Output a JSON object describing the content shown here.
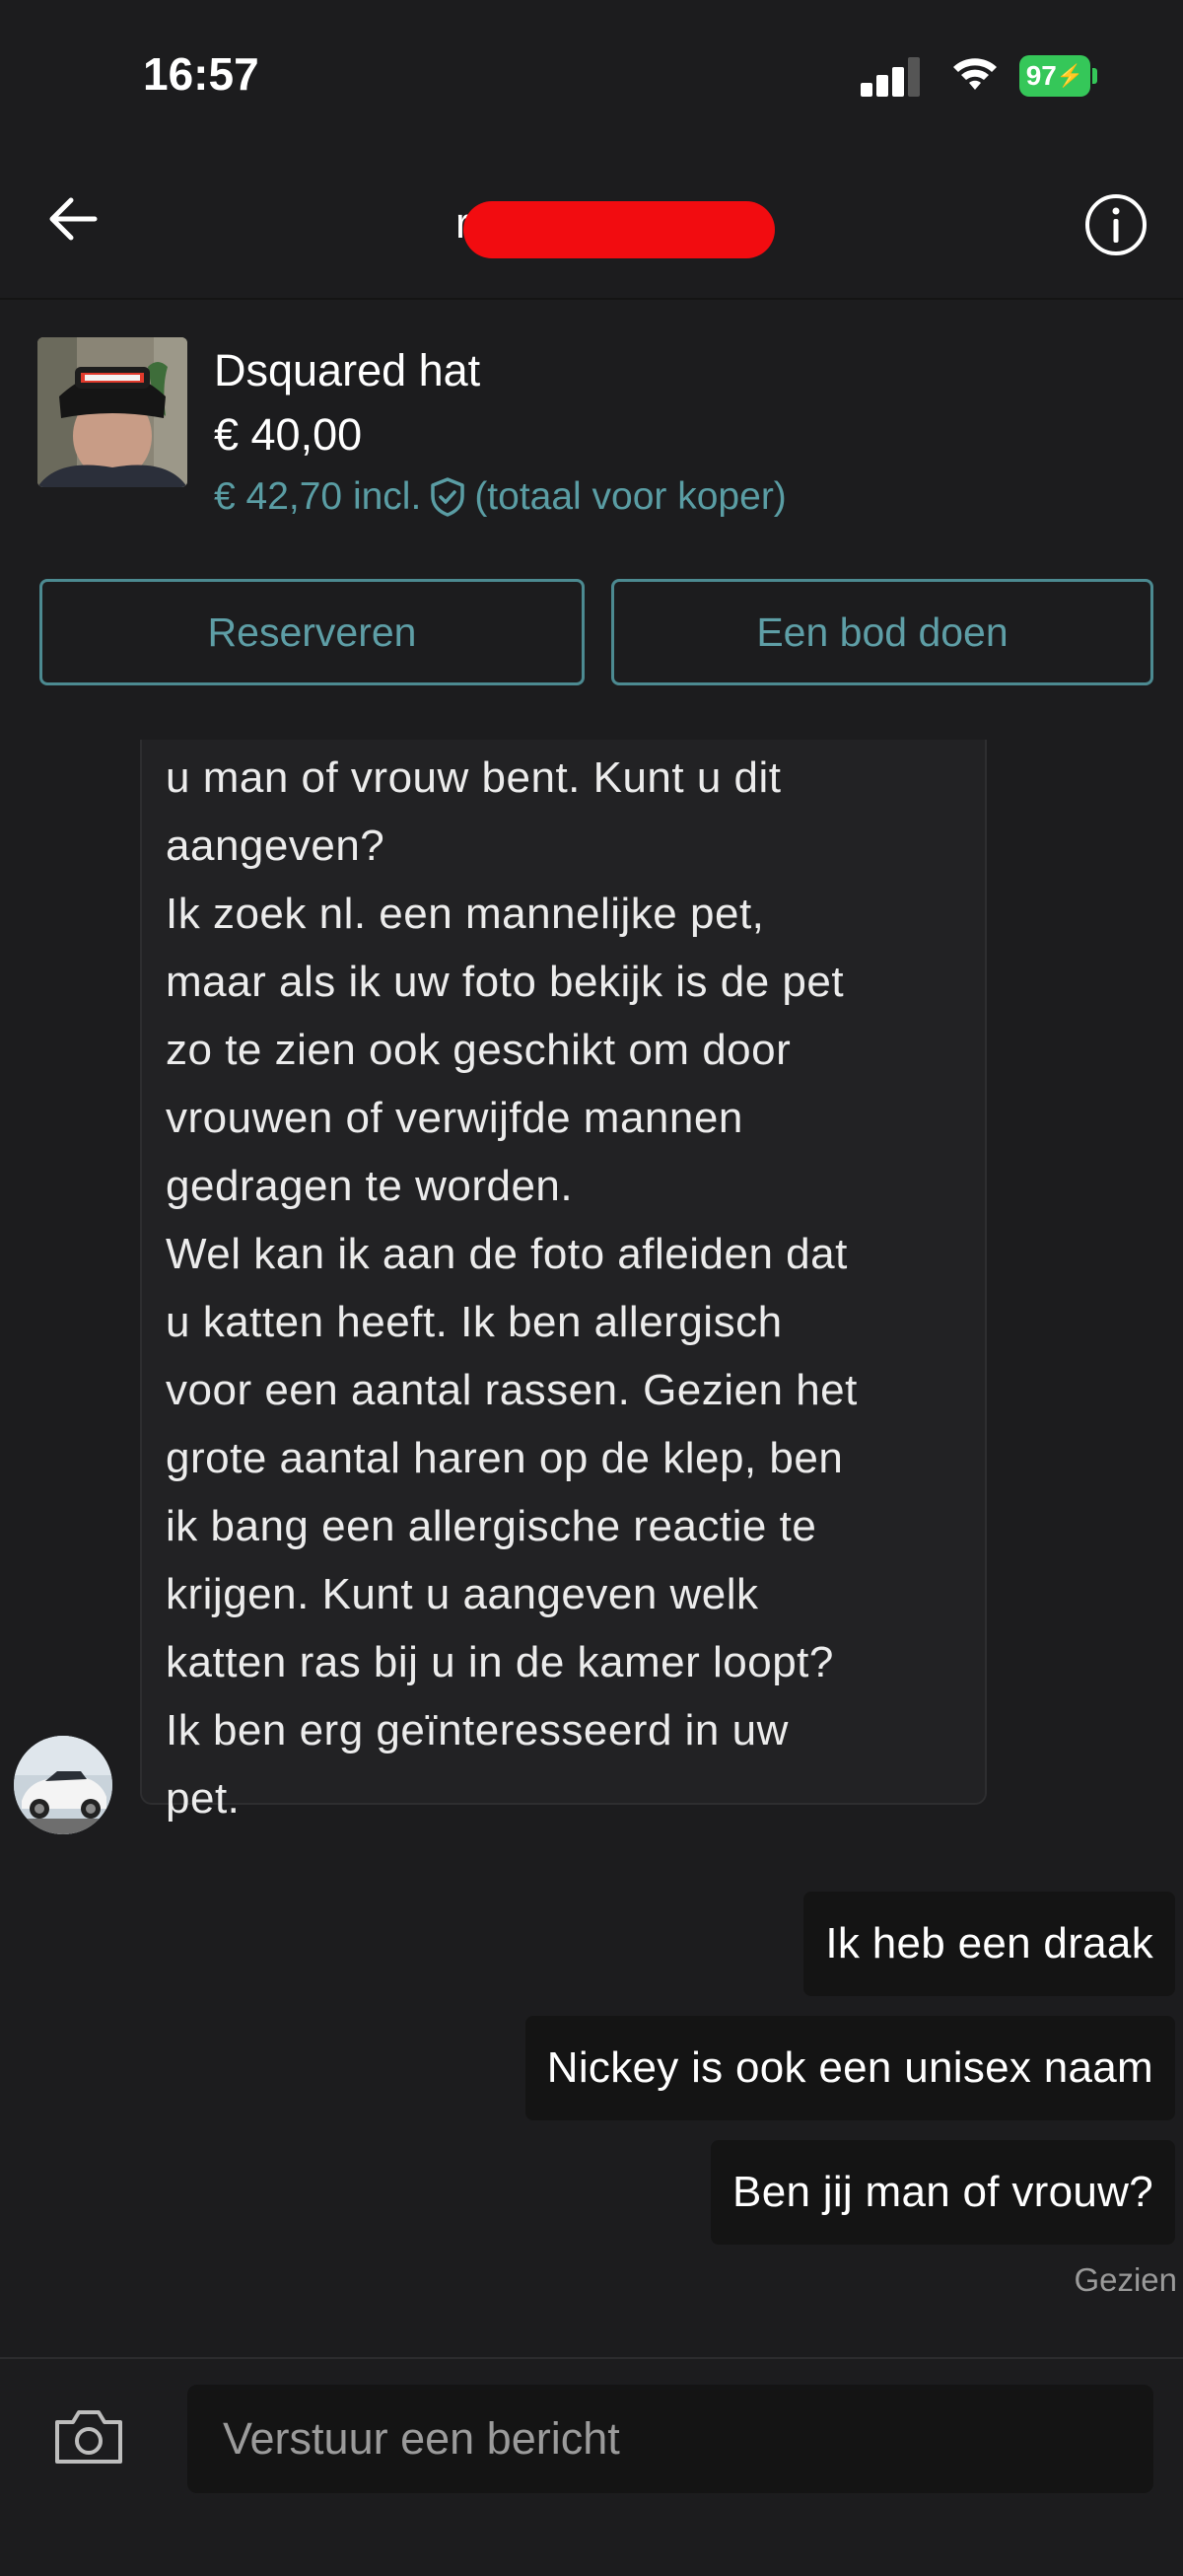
{
  "status_bar": {
    "time": "16:57",
    "battery_level": "97",
    "battery_charging": true,
    "signal_bars_active": 3,
    "signal_bars_total": 4
  },
  "header": {
    "title_visible_fragment": "r",
    "title_redacted": true,
    "back_icon": "arrow-left-icon",
    "info_icon": "info-icon"
  },
  "item": {
    "title": "Dsquared hat",
    "price": "€ 40,00",
    "price_incl": "€ 42,70 incl.",
    "buyer_total_note": "(totaal voor koper)",
    "protection_icon": "shield-check-icon",
    "reserve_label": "Reserveren",
    "offer_label": "Een bod doen"
  },
  "messages": {
    "incoming": [
      {
        "text": "u man of vrouw bent. Kunt u dit\naangeven?\nIk zoek nl. een mannelijke pet,\nmaar als ik uw foto bekijk is de pet\nzo te zien ook geschikt om door\nvrouwen of verwijfde mannen\ngedragen te worden.\nWel kan ik aan de foto afleiden dat\nu katten heeft. Ik ben allergisch\nvoor een aantal rassen. Gezien het\ngrote aantal haren op de klep, ben\nik bang een allergische reactie te\nkrijgen. Kunt u aangeven welk\nkatten ras bij u in de kamer loopt?\nIk ben erg geïnteresseerd in uw\npet."
      }
    ],
    "outgoing": [
      {
        "text": "Ik heb een draak"
      },
      {
        "text": "Nickey is ook een unisex naam"
      },
      {
        "text": "Ben jij man of vrouw?"
      }
    ],
    "seen_label": "Gezien"
  },
  "composer": {
    "placeholder": "Verstuur een bericht",
    "camera_icon": "camera-icon"
  },
  "colors": {
    "background": "#1c1c1e",
    "accent_teal": "#5a9da4",
    "bubble_outgoing": "#141414",
    "bubble_incoming": "#222224",
    "battery_green": "#35c759",
    "redaction_red": "#f20c10"
  }
}
